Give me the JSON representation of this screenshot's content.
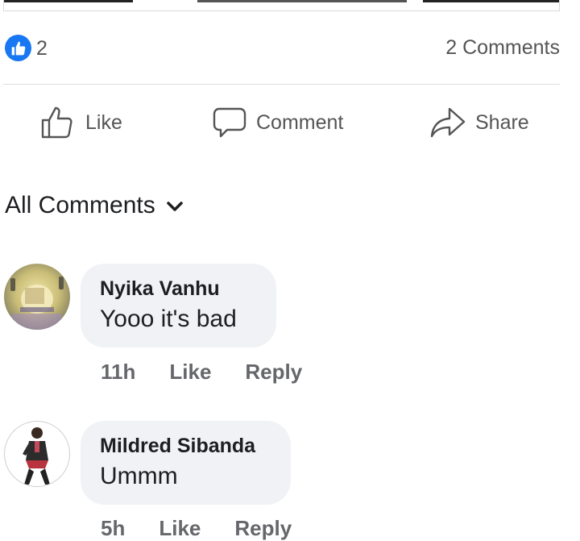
{
  "post": {
    "reaction_count": "2",
    "comments_count": "2 Comments",
    "like_badge_icon": "thumbs-up-icon",
    "brand_color": "#1877f2"
  },
  "actions": {
    "like": {
      "label": "Like",
      "icon": "thumbs-up-outline-icon"
    },
    "comment": {
      "label": "Comment",
      "icon": "speech-bubble-icon"
    },
    "share": {
      "label": "Share",
      "icon": "share-arrow-icon"
    }
  },
  "comments_header": {
    "label": "All Comments",
    "icon": "chevron-down-icon"
  },
  "comments": [
    {
      "author": "Nyika Vanhu",
      "text": "Yooo it's bad",
      "time": "11h",
      "like_label": "Like",
      "reply_label": "Reply"
    },
    {
      "author": "Mildred Sibanda",
      "text": "Ummm",
      "time": "5h",
      "like_label": "Like",
      "reply_label": "Reply"
    }
  ]
}
